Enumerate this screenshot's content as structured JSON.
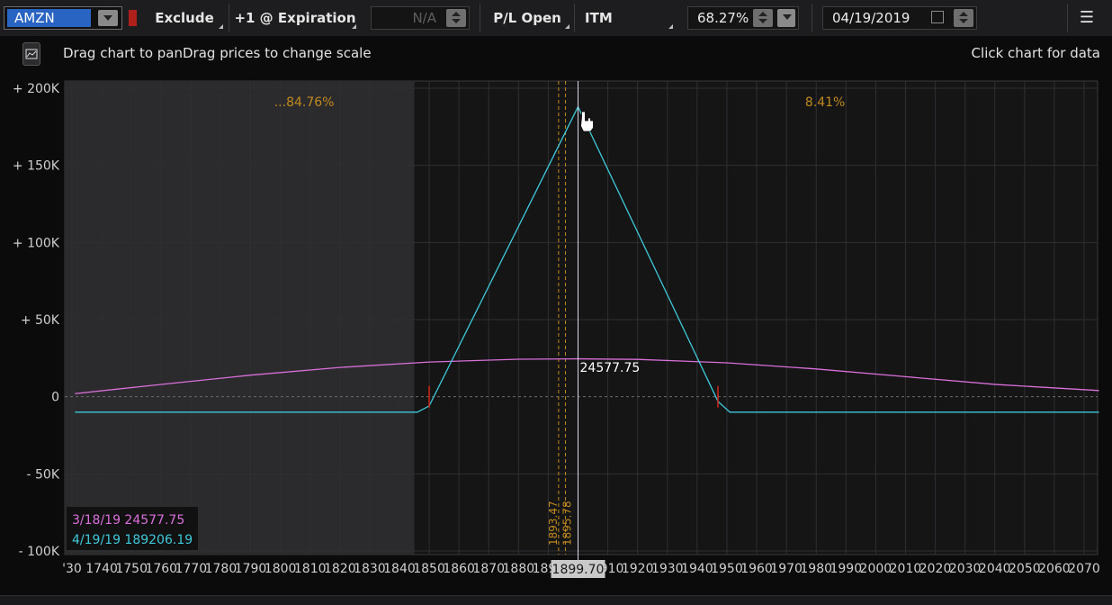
{
  "toolbar": {
    "symbol": "AMZN",
    "exclude_label": "Exclude",
    "expiration_label": "+1 @ Expiration",
    "na_value": "N/A",
    "pl_open_label": "P/L Open",
    "itm_label": "ITM",
    "volatility_value": "68.27%",
    "date_value": "04/19/2019"
  },
  "hints": {
    "drag_text": "Drag chart to panDrag prices to change scale",
    "click_text": "Click chart for data"
  },
  "colors": {
    "background": "#0b0b0c",
    "shaded_region": "#2b2b2d",
    "plot_region": "#151516",
    "expiration_line": "#3ec9d9",
    "today_line": "#d96fd9",
    "probability_text": "#c08a1e",
    "breakeven_mark": "#d0281c",
    "cursor_line": "#d8d8e8"
  },
  "chart_data": {
    "type": "line",
    "xlabel": "",
    "ylabel": "",
    "xlim": [
      1728,
      2075
    ],
    "ylim": [
      -100000,
      200000
    ],
    "y_ticks": [
      200000,
      150000,
      100000,
      50000,
      0,
      -50000,
      -100000
    ],
    "y_tick_labels": [
      "+ 200K",
      "+ 150K",
      "+ 100K",
      "+ 50K",
      "0",
      "- 50K",
      "- 100K"
    ],
    "x_tick_labels": [
      "'30",
      "1740",
      "1750",
      "1760",
      "1770",
      "1780",
      "1790",
      "1800",
      "1810",
      "1820",
      "1830",
      "1840",
      "1850",
      "1860",
      "1870",
      "1880",
      "1890",
      "1900",
      "1910",
      "1920",
      "1930",
      "1940",
      "1950",
      "1960",
      "1970",
      "1980",
      "1990",
      "2000",
      "2010",
      "2020",
      "2030",
      "2040",
      "2050",
      "2060",
      "2070"
    ],
    "x_tick_values": [
      1730,
      1740,
      1750,
      1760,
      1770,
      1780,
      1790,
      1800,
      1810,
      1820,
      1830,
      1840,
      1850,
      1860,
      1870,
      1880,
      1890,
      1900,
      1910,
      1920,
      1930,
      1940,
      1950,
      1960,
      1970,
      1980,
      1990,
      2000,
      2010,
      2020,
      2030,
      2040,
      2050,
      2060,
      2070
    ],
    "shaded_region": [
      1728,
      1845
    ],
    "series": [
      {
        "name": "4/19/19",
        "role": "expiration",
        "x": [
          1731,
          1846,
          1850,
          1900,
          1947,
          1951,
          2075
        ],
        "y": [
          -10000,
          -10000,
          -6000,
          188000,
          -3000,
          -10000,
          -10000
        ]
      },
      {
        "name": "3/18/19",
        "role": "today",
        "x": [
          1731,
          1760,
          1790,
          1820,
          1850,
          1880,
          1900,
          1920,
          1950,
          1980,
          2010,
          2040,
          2075
        ],
        "y": [
          2000,
          8000,
          14000,
          19000,
          22500,
          24300,
          24578,
          24200,
          22000,
          18000,
          13000,
          8000,
          4000
        ]
      }
    ],
    "cursor": {
      "x": 1900,
      "label": "1899.70",
      "value_label": "24577.75"
    },
    "dashed_lines": [
      {
        "x": 1893.47,
        "label": "1893.47"
      },
      {
        "x": 1895.78,
        "label": "1895.78"
      }
    ],
    "breakevens": [
      1850,
      1947
    ],
    "probabilities": [
      {
        "label": "...84.76%",
        "x": 1808
      },
      {
        "label": "8.41%",
        "x": 1983
      }
    ],
    "legend": [
      {
        "label": "3/18/19 24577.75",
        "role": "today"
      },
      {
        "label": "4/19/19 189206.19",
        "role": "expiration"
      }
    ]
  }
}
